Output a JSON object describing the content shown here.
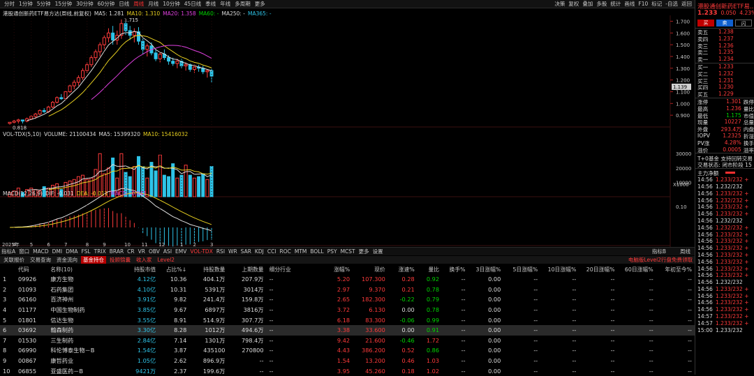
{
  "topbar": {
    "items": [
      "分时",
      "1分钟",
      "5分钟",
      "15分钟",
      "30分钟",
      "60分钟",
      "日线",
      "周线",
      "月线",
      "10分钟",
      "45日线",
      "季线",
      "年线",
      "多周期",
      "更多"
    ],
    "active_index": 7,
    "tools": [
      "决策",
      "复权",
      "叠加",
      "多股",
      "统计",
      "画线",
      "F10",
      "标记",
      "-自选",
      "返回"
    ]
  },
  "chart": {
    "title": "港股通创新药ETF易方达(周线,前复权)",
    "ma5_label": "MA5: 1.281",
    "ma10_label": "MA10: 1.310",
    "ma20_label": "MA20: 1.358",
    "ma60_label": "MA60: -",
    "ma250_label": "MA250: -",
    "ma365_label": "MA365: -",
    "high_label": "1.715",
    "low_label": "0.818",
    "current_tag": "1.139",
    "y_ticks": [
      "1.700",
      "1.600",
      "1.500",
      "1.400",
      "1.300",
      "1.200",
      "1.100",
      "1.000",
      "0.900"
    ]
  },
  "volume": {
    "header": "VOL-TDX(5,10)",
    "vol_label": "VOLUME: 21100434",
    "ma5_label": "MA5: 15399320",
    "ma10_label": "MA10: 15416032",
    "y_ticks": [
      "30000",
      "20000",
      "10000"
    ],
    "unit": "X1000"
  },
  "macd": {
    "header": "MACD(12,26,9)",
    "dif_label": "DIF: -0.031",
    "dea_label": "DEA: -0.011",
    "macd_label": "MACD: -0.041",
    "y_ticks": [
      "0.10"
    ]
  },
  "x_axis": {
    "year": "2025年",
    "months": [
      "4",
      "5",
      "6",
      "7",
      "8",
      "9",
      "10",
      "11",
      "12",
      "1",
      "2",
      "3"
    ]
  },
  "indicators": [
    "指标A",
    "窗口",
    "MACD",
    "DMI",
    "DMA",
    "FSL",
    "TRIX",
    "BRAR",
    "CR",
    "VR",
    "OBV",
    "ASI",
    "EMV",
    "VOL-TDX",
    "RSI",
    "WR",
    "SAR",
    "KDJ",
    "CCI",
    "ROC",
    "MTM",
    "BOLL",
    "PSY",
    "MCST",
    "更多",
    "设置"
  ],
  "indicators_active": "VOL-TDX",
  "indicators_right": [
    "指标B",
    "周线"
  ],
  "tabs": [
    "关联报价",
    "交易查询",
    "资金流向",
    "基金持仓",
    "投顾锦囊",
    "收入家",
    "Level2"
  ],
  "tabs_selected": "基金持仓",
  "tabs_right": "电脑版Level2行盘免费领取",
  "table": {
    "headers": [
      "",
      "代码",
      "名称(10)",
      "持股市值",
      "占比%↓",
      "持股数量",
      "上期数量",
      "细分行业",
      "涨幅%",
      "现价",
      "涨速%",
      "量比",
      "换手%",
      "3日涨幅%",
      "5日涨幅%",
      "10日涨幅%",
      "20日涨幅%",
      "60日涨幅%",
      "年初至今%"
    ],
    "rows": [
      [
        "1",
        "09926",
        "康方生物",
        "4.12亿",
        "10.36",
        "404.1万",
        "207.9万",
        "--",
        "5.20",
        "107.300",
        "0.28",
        "0.92",
        "--",
        "0.00",
        "--",
        "--",
        "--",
        "--",
        "--"
      ],
      [
        "2",
        "01093",
        "石药集团",
        "4.10亿",
        "10.31",
        "5391万",
        "3014万",
        "--",
        "2.97",
        "9.370",
        "0.21",
        "0.78",
        "--",
        "0.00",
        "--",
        "--",
        "--",
        "--",
        "--"
      ],
      [
        "3",
        "06160",
        "百济神州",
        "3.91亿",
        "9.82",
        "241.4万",
        "159.8万",
        "--",
        "2.65",
        "182.300",
        "-0.22",
        "0.79",
        "--",
        "0.00",
        "--",
        "--",
        "--",
        "--",
        "--"
      ],
      [
        "4",
        "01177",
        "中国生物制药",
        "3.85亿",
        "9.67",
        "6897万",
        "3816万",
        "--",
        "3.72",
        "6.130",
        "0.00",
        "0.78",
        "--",
        "0.00",
        "--",
        "--",
        "--",
        "--",
        "--"
      ],
      [
        "5",
        "01801",
        "信达生物",
        "3.55亿",
        "8.91",
        "514.9万",
        "307.7万",
        "--",
        "6.18",
        "83.300",
        "-0.06",
        "0.99",
        "--",
        "0.00",
        "--",
        "--",
        "--",
        "--",
        "--"
      ],
      [
        "6",
        "03692",
        "翰森制药",
        "3.30亿",
        "8.28",
        "1012万",
        "494.6万",
        "--",
        "3.38",
        "33.600",
        "0.00",
        "0.91",
        "--",
        "0.00",
        "--",
        "--",
        "--",
        "--",
        "--"
      ],
      [
        "7",
        "01530",
        "三生制药",
        "2.84亿",
        "7.14",
        "1301万",
        "798.4万",
        "--",
        "9.42",
        "21.600",
        "-0.46",
        "1.72",
        "--",
        "0.00",
        "--",
        "--",
        "--",
        "--",
        "--"
      ],
      [
        "8",
        "06990",
        "科伦博泰生物－B",
        "1.54亿",
        "3.87",
        "435100",
        "270800",
        "--",
        "4.43",
        "386.200",
        "0.52",
        "0.86",
        "--",
        "0.00",
        "--",
        "--",
        "--",
        "--",
        "--"
      ],
      [
        "9",
        "00867",
        "康哲药业",
        "1.05亿",
        "2.62",
        "896.9万",
        "--",
        "--",
        "1.54",
        "13.200",
        "0.46",
        "1.03",
        "--",
        "0.00",
        "--",
        "--",
        "--",
        "--",
        "--"
      ],
      [
        "10",
        "06855",
        "亚盛医药－B",
        "9421万",
        "2.37",
        "199.6万",
        "--",
        "--",
        "3.95",
        "45.260",
        "0.18",
        "1.02",
        "--",
        "0.00",
        "--",
        "--",
        "--",
        "--",
        "--"
      ]
    ],
    "selected_row": 5
  },
  "panel": {
    "title": "港股通创新药ETF易...",
    "price": "1.233",
    "change": "0.050",
    "pct": "4.23%",
    "buttons": [
      "买",
      "卖",
      "闪"
    ],
    "asks": [
      [
        "卖五",
        "1.238"
      ],
      [
        "卖四",
        "1.237"
      ],
      [
        "卖三",
        "1.236"
      ],
      [
        "卖二",
        "1.235"
      ],
      [
        "卖一",
        "1.234"
      ]
    ],
    "bids": [
      [
        "买一",
        "1.233"
      ],
      [
        "买二",
        "1.232"
      ],
      [
        "买三",
        "1.231"
      ],
      [
        "买四",
        "1.230"
      ],
      [
        "买五",
        "1.229"
      ]
    ],
    "stats": [
      [
        "涨停",
        "1.301",
        "跌停"
      ],
      [
        "最高",
        "1.236",
        "量比"
      ],
      [
        "最低",
        "1.175",
        "市值"
      ],
      [
        "现量",
        "10227",
        "总量"
      ],
      [
        "外盘",
        "293.4万",
        "内盘"
      ],
      [
        "IOPV",
        "1.2325",
        "折溢"
      ],
      [
        "PV涨",
        "4.28%",
        "换手"
      ],
      [
        "溢价",
        "0.0005",
        "溢率"
      ]
    ],
    "t0": "T+0基金 支持回转交易",
    "status": "交易状态: 闭市阶段 15",
    "main_label": "主力净额",
    "ticks": [
      [
        "14:56",
        "1.233/232 +"
      ],
      [
        "14:56",
        "1.232/232"
      ],
      [
        "14:56",
        "1.233/232 +"
      ],
      [
        "14:56",
        "1.232/232 +"
      ],
      [
        "14:56",
        "1.233/232 +"
      ],
      [
        "14:56",
        "1.233/232 +"
      ],
      [
        "14:56",
        "1.232/232"
      ],
      [
        "14:56",
        "1.232/232 +"
      ],
      [
        "14:56",
        "1.233/232 +"
      ],
      [
        "14:56",
        "1.233/232 +"
      ],
      [
        "14:56",
        "1.233/232 +"
      ],
      [
        "14:56",
        "1.233/232 +"
      ],
      [
        "14:56",
        "1.233/232 +"
      ],
      [
        "14:56",
        "1.233/232 +"
      ],
      [
        "14:56",
        "1.233/232 +"
      ],
      [
        "14:56",
        "1.232/232"
      ],
      [
        "14:56",
        "1.233/232 +"
      ],
      [
        "14:56",
        "1.233/232 +"
      ],
      [
        "14:56",
        "1.233/232 +"
      ],
      [
        "14:56",
        "1.233/232 +"
      ],
      [
        "14:57",
        "1.233/232 +"
      ],
      [
        "14:57",
        "1.233/232 +"
      ],
      [
        "15:00",
        "1.233/232"
      ]
    ]
  },
  "colors": {
    "up": "#ff3b3b",
    "down": "#00d600",
    "cyan": "#2ec4e8",
    "yellow": "#e8d020",
    "magenta": "#e040e0"
  }
}
